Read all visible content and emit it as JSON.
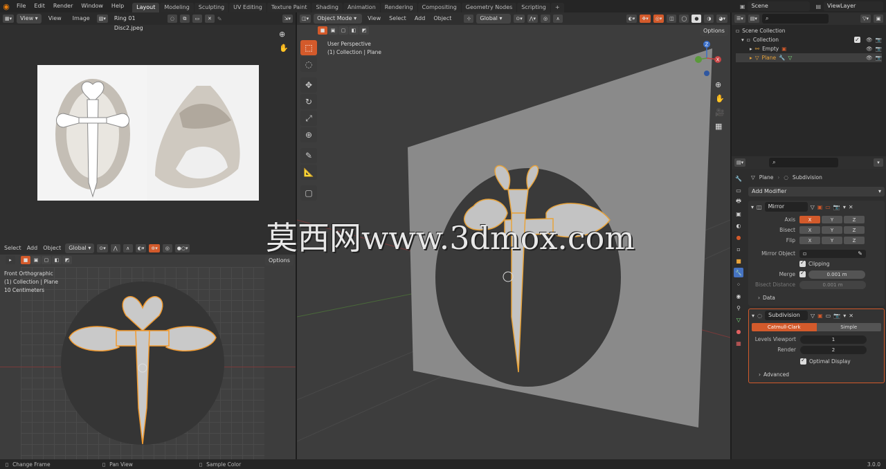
{
  "topbar": {
    "menus": [
      "File",
      "Edit",
      "Render",
      "Window",
      "Help"
    ],
    "tabs": [
      "Layout",
      "Modeling",
      "Sculpting",
      "UV Editing",
      "Texture Paint",
      "Shading",
      "Animation",
      "Rendering",
      "Compositing",
      "Geometry Nodes",
      "Scripting"
    ],
    "active_tab": "Layout",
    "scene": "Scene",
    "view_layer": "ViewLayer"
  },
  "image_editor": {
    "view_mode": "View",
    "menus": [
      "View",
      "Image"
    ],
    "image_name": "Ring 01 Disc2.jpeg"
  },
  "front_view": {
    "menus": [
      "Select",
      "Add",
      "Object"
    ],
    "transform": "Global",
    "options": "Options",
    "overlay_lines": [
      "Front Orthographic",
      "(1) Collection | Plane",
      "10 Centimeters"
    ]
  },
  "main_view": {
    "mode": "Object Mode",
    "menus": [
      "View",
      "Select",
      "Add",
      "Object"
    ],
    "transform": "Global",
    "options": "Options",
    "overlay_lines": [
      "User Perspective",
      "(1) Collection | Plane"
    ],
    "watermark": "莫西网www.3dmox.com"
  },
  "outliner": {
    "root": "Scene Collection",
    "collection": "Collection",
    "items": [
      "Empty",
      "Plane"
    ]
  },
  "properties": {
    "breadcrumb_object": "Plane",
    "breadcrumb_modifier": "Subdivision",
    "add_modifier": "Add Modifier",
    "mirror": {
      "name": "Mirror",
      "axis_label": "Axis",
      "bisect_label": "Bisect",
      "flip_label": "Flip",
      "axes": [
        "X",
        "Y",
        "Z"
      ],
      "mirror_object_label": "Mirror Object",
      "clipping_label": "Clipping",
      "merge_label": "Merge",
      "merge_value": "0.001 m",
      "bisect_distance_label": "Bisect Distance",
      "bisect_distance_value": "0.001 m",
      "data_label": "Data"
    },
    "subdivision": {
      "name": "Subdivision",
      "catmull": "Catmull-Clark",
      "simple": "Simple",
      "levels_label": "Levels Viewport",
      "levels_value": "1",
      "render_label": "Render",
      "render_value": "2",
      "optimal_label": "Optimal Display",
      "advanced_label": "Advanced"
    }
  },
  "statusbar": {
    "items": [
      "Change Frame",
      "Pan View",
      "Sample Color"
    ],
    "version": "3.0.0"
  },
  "colors": {
    "accent": "#d35a2b",
    "selected": "#e8a33a",
    "bg": "#1d1d1d"
  }
}
